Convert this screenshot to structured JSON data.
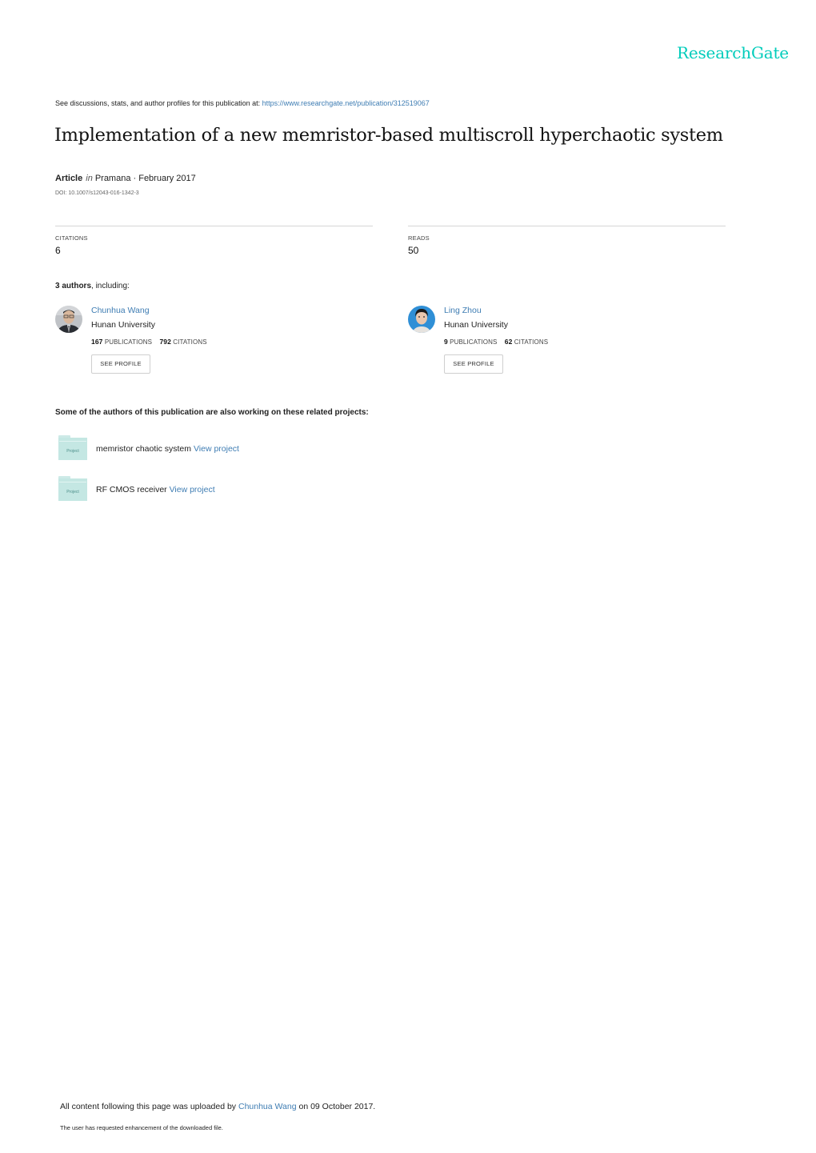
{
  "header": {
    "logo_text": "ResearchGate",
    "brand_color": "#00ccbb"
  },
  "intro": {
    "text": "See discussions, stats, and author profiles for this publication at:",
    "url_text": "https://www.researchgate.net/publication/312519067"
  },
  "publication": {
    "title": "Implementation of a new memristor-based multiscroll hyperchaotic system",
    "type": "Article",
    "in_word": "in",
    "journal_date": "Pramana · February 2017",
    "doi": "DOI: 10.1007/s12043-016-1342-3"
  },
  "stats": {
    "citations_label": "CITATIONS",
    "citations_value": "6",
    "reads_label": "READS",
    "reads_value": "50"
  },
  "authors": {
    "count_bold": "3 authors",
    "count_rest": ", including:",
    "list": [
      {
        "name": "Chunhua Wang",
        "institution": "Hunan University",
        "publications": "167",
        "publications_label": "PUBLICATIONS",
        "citations": "792",
        "citations_label": "CITATIONS",
        "button_label": "SEE PROFILE"
      },
      {
        "name": "Ling Zhou",
        "institution": "Hunan University",
        "publications": "9",
        "publications_label": "PUBLICATIONS",
        "citations": "62",
        "citations_label": "CITATIONS",
        "button_label": "SEE PROFILE"
      }
    ]
  },
  "projects": {
    "heading": "Some of the authors of this publication are also working on these related projects:",
    "icon_label": "Project",
    "items": [
      {
        "name": "memristor chaotic system",
        "link": "View project"
      },
      {
        "name": "RF CMOS receiver",
        "link": "View project"
      }
    ]
  },
  "footer": {
    "upload_prefix": "All content following this page was uploaded by",
    "uploader": "Chunhua Wang",
    "upload_suffix": "on 09 October 2017.",
    "note": "The user has requested enhancement of the downloaded file."
  },
  "colors": {
    "link": "#3f7db3",
    "folder": "#c4e7e3"
  }
}
